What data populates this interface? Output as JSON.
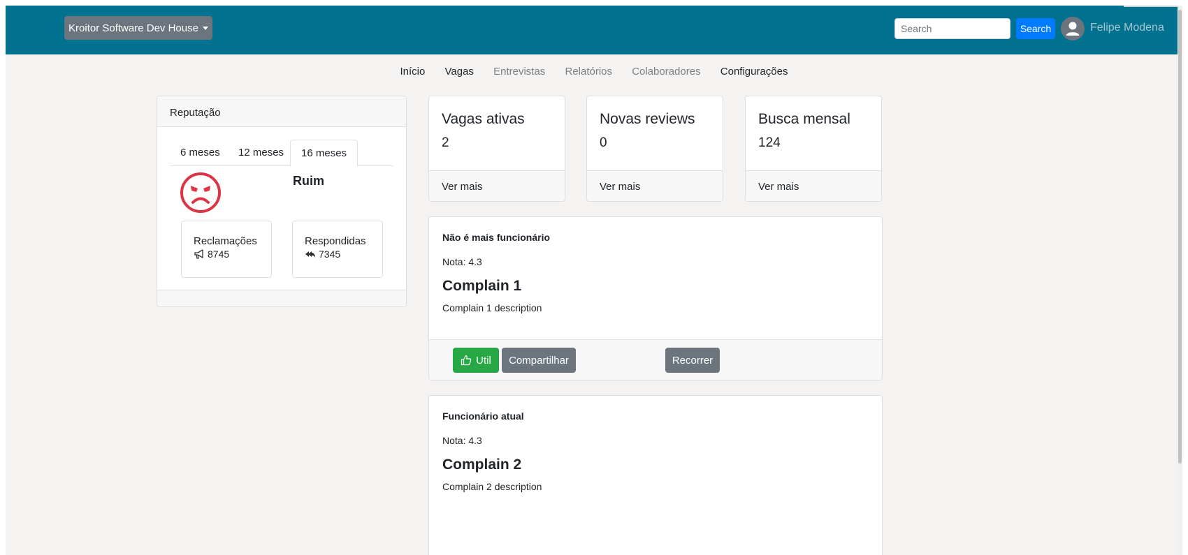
{
  "header": {
    "company": "Kroitor Software Dev House",
    "search_placeholder": "Search",
    "search_button": "Search",
    "user_name": "Felipe Modena"
  },
  "nav": {
    "items": [
      {
        "label": "Início",
        "active": true
      },
      {
        "label": "Vagas",
        "active": true
      },
      {
        "label": "Entrevistas",
        "active": false
      },
      {
        "label": "Relatórios",
        "active": false
      },
      {
        "label": "Colaboradores",
        "active": false
      },
      {
        "label": "Configurações",
        "active": true
      }
    ]
  },
  "reputation": {
    "title": "Reputação",
    "tabs": [
      "6 meses",
      "12 meses",
      "16 meses"
    ],
    "active_tab": "16 meses",
    "status_icon": "angry-face-icon",
    "status_label": "Ruim",
    "complaints_label": "Reclamações",
    "complaints_value": "8745",
    "answered_label": "Respondidas",
    "answered_value": "7345"
  },
  "stats": [
    {
      "title": "Vagas ativas",
      "value": "2",
      "link": "Ver mais"
    },
    {
      "title": "Novas reviews",
      "value": "0",
      "link": "Ver mais"
    },
    {
      "title": "Busca mensal",
      "value": "124",
      "link": "Ver mais"
    }
  ],
  "complaints": [
    {
      "type": "Não é mais funcionário",
      "nota": "Nota: 4.3",
      "title": "Complain 1",
      "description": "Complain 1 description",
      "util_label": "Util",
      "share_label": "Compartilhar",
      "appeal_label": "Recorrer"
    },
    {
      "type": "Funcionário atual",
      "nota": "Nota: 4.3",
      "title": "Complain 2",
      "description": "Complain 2 description"
    }
  ],
  "colors": {
    "topbar": "#00718f",
    "primary": "#007bff",
    "success": "#28a745",
    "secondary": "#6c757d",
    "danger": "#dc3545",
    "background": "#f5f3f2"
  }
}
